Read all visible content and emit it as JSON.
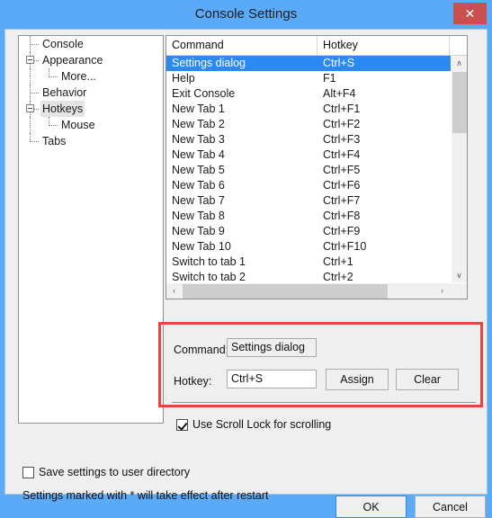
{
  "window": {
    "title": "Console Settings",
    "close_label": "✕",
    "title_bar_color": "#5aaaf7",
    "close_button_color": "#c9504f",
    "client_bg_color": "#efefef"
  },
  "tree": {
    "items": [
      {
        "label": "Console",
        "level": 1,
        "expander": false,
        "selected": false
      },
      {
        "label": "Appearance",
        "level": 1,
        "expander": true,
        "selected": false
      },
      {
        "label": "More...",
        "level": 2,
        "expander": false,
        "selected": false
      },
      {
        "label": "Behavior",
        "level": 1,
        "expander": false,
        "selected": false
      },
      {
        "label": "Hotkeys",
        "level": 1,
        "expander": true,
        "selected": true
      },
      {
        "label": "Mouse",
        "level": 2,
        "expander": false,
        "selected": false
      },
      {
        "label": "Tabs",
        "level": 1,
        "expander": false,
        "selected": false
      }
    ]
  },
  "list": {
    "columns": [
      "Command",
      "Hotkey"
    ],
    "selected_index": 0,
    "selection_color": "#2a8aef",
    "rows": [
      {
        "command": "Settings dialog",
        "hotkey": "Ctrl+S"
      },
      {
        "command": "Help",
        "hotkey": "F1"
      },
      {
        "command": "Exit Console",
        "hotkey": "Alt+F4"
      },
      {
        "command": "New Tab 1",
        "hotkey": "Ctrl+F1"
      },
      {
        "command": "New Tab 2",
        "hotkey": "Ctrl+F2"
      },
      {
        "command": "New Tab 3",
        "hotkey": "Ctrl+F3"
      },
      {
        "command": "New Tab 4",
        "hotkey": "Ctrl+F4"
      },
      {
        "command": "New Tab 5",
        "hotkey": "Ctrl+F5"
      },
      {
        "command": "New Tab 6",
        "hotkey": "Ctrl+F6"
      },
      {
        "command": "New Tab 7",
        "hotkey": "Ctrl+F7"
      },
      {
        "command": "New Tab 8",
        "hotkey": "Ctrl+F8"
      },
      {
        "command": "New Tab 9",
        "hotkey": "Ctrl+F9"
      },
      {
        "command": "New Tab 10",
        "hotkey": "Ctrl+F10"
      },
      {
        "command": "Switch to tab 1",
        "hotkey": "Ctrl+1"
      },
      {
        "command": "Switch to tab 2",
        "hotkey": "Ctrl+2"
      }
    ],
    "scroll_up_glyph": "∧",
    "scroll_down_glyph": "∨",
    "scroll_left_glyph": "‹",
    "scroll_right_glyph": "›"
  },
  "form": {
    "command_label": "Command:",
    "command_value": "Settings dialog",
    "hotkey_label": "Hotkey:",
    "hotkey_value": "Ctrl+S",
    "assign_label": "Assign",
    "clear_label": "Clear",
    "highlight_color": "#e8453c"
  },
  "options": {
    "scroll_lock_label": "Use Scroll Lock for scrolling",
    "scroll_lock_checked": true,
    "save_settings_label": "Save settings to user directory",
    "save_settings_checked": false
  },
  "footer": {
    "restart_note": "Settings marked with * will take effect after restart",
    "ok_label": "OK",
    "cancel_label": "Cancel"
  }
}
